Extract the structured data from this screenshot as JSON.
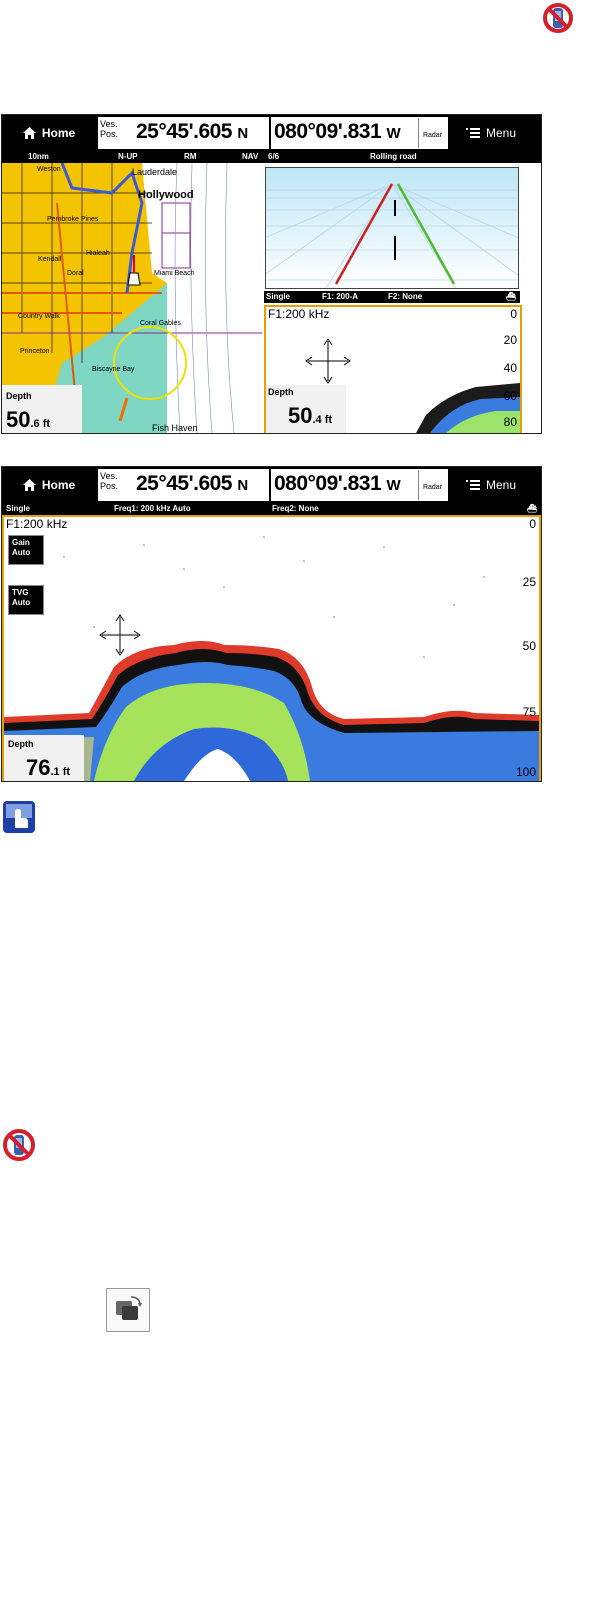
{
  "screen1": {
    "home": "Home",
    "menu": "Menu",
    "pos_label": "Ves.\nPos.",
    "lat": "25°45'.605",
    "lat_hemi": "N",
    "lon": "080°09'.831",
    "lon_hemi": "W",
    "radar": "Radar",
    "info": {
      "range": "10nm",
      "orient": "N-UP",
      "mode": "RM",
      "nav": "NAV",
      "page": "6/6",
      "view": "Rolling road"
    },
    "sonar_bar": {
      "mode": "Single",
      "f1": "F1: 200-A",
      "f2": "F2: None"
    },
    "freq": "F1:200 kHz",
    "scale": [
      "0",
      "20",
      "40",
      "60",
      "80"
    ],
    "chart_depth": {
      "label": "Depth",
      "value": "50",
      "unit": ".6 ft"
    },
    "sonar_depth": {
      "label": "Depth",
      "value": "50",
      "unit": ".4 ft"
    },
    "map_labels": [
      "Lauderdale",
      "Hollywood",
      "Pembroke Pines",
      "Kendall",
      "Doral",
      "Hialeah",
      "Miami Beach",
      "Coral Gables",
      "Country Walk",
      "Princeton",
      "Biscayne Bay",
      "Fish Haven",
      "Weston"
    ]
  },
  "screen2": {
    "home": "Home",
    "menu": "Menu",
    "pos_label": "Ves.\nPos.",
    "lat": "25°45'.605",
    "lat_hemi": "N",
    "lon": "080°09'.831",
    "lon_hemi": "W",
    "radar": "Radar",
    "info": {
      "mode": "Single",
      "freq1": "Freq1: 200 kHz Auto",
      "freq2": "Freq2: None"
    },
    "freq": "F1:200 kHz",
    "gain": {
      "title": "Gain",
      "value": "Auto"
    },
    "tvg": {
      "title": "TVG",
      "value": "Auto"
    },
    "scale": [
      "0",
      "25",
      "50",
      "75",
      "100"
    ],
    "depth": {
      "label": "Depth",
      "value": "76",
      "unit": ".1 ft"
    }
  },
  "colors": {
    "chart_land": "#f5c400",
    "water": "#ffffff",
    "shallow": "#7fd6c2",
    "highlight": "#e8a000",
    "road_left": "#d21f1f",
    "road_right": "#4dbb2a"
  }
}
